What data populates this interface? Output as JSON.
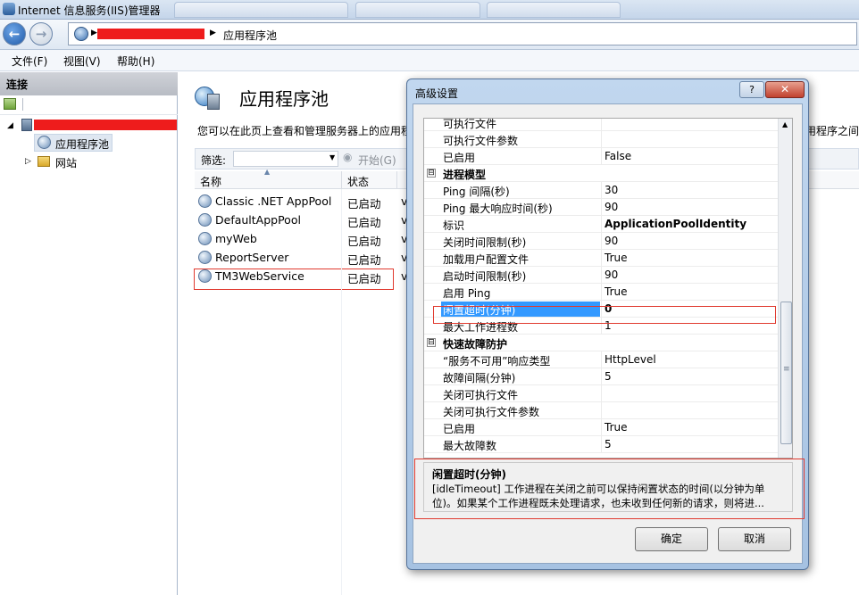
{
  "window": {
    "title": "Internet 信息服务(IIS)管理器"
  },
  "address": {
    "breadcrumb": "应用程序池"
  },
  "menu": [
    "文件(F)",
    "视图(V)",
    "帮助(H)"
  ],
  "connections": {
    "header": "连接",
    "tree": {
      "app_pools": "应用程序池",
      "sites": "网站"
    }
  },
  "main": {
    "title": "应用程序池",
    "description": "您可以在此页上查看和管理服务器上的应用程",
    "description_tail": "用程序之间",
    "filter_label": "筛选:",
    "start_label": "开始(G)",
    "columns": [
      "名称",
      "状态"
    ],
    "pools": [
      {
        "name": "Classic .NET AppPool",
        "status": "已启动",
        "extra": "v"
      },
      {
        "name": "DefaultAppPool",
        "status": "已启动",
        "extra": "v"
      },
      {
        "name": "myWeb",
        "status": "已启动",
        "extra": "v"
      },
      {
        "name": "ReportServer",
        "status": "已启动",
        "extra": "v"
      },
      {
        "name": "TM3WebService",
        "status": "已启动",
        "extra": "v"
      }
    ]
  },
  "dialog": {
    "title": "高级设置",
    "help": "?",
    "rows": [
      {
        "name": "可执行文件",
        "value": ""
      },
      {
        "name": "可执行文件参数",
        "value": ""
      },
      {
        "name": "已启用",
        "value": "False"
      },
      {
        "name": "进程模型",
        "value": "",
        "category": "⊟"
      },
      {
        "name": "Ping 间隔(秒)",
        "value": "30"
      },
      {
        "name": "Ping 最大响应时间(秒)",
        "value": "90"
      },
      {
        "name": "标识",
        "value": "ApplicationPoolIdentity"
      },
      {
        "name": "关闭时间限制(秒)",
        "value": "90"
      },
      {
        "name": "加载用户配置文件",
        "value": "True"
      },
      {
        "name": "启动时间限制(秒)",
        "value": "90"
      },
      {
        "name": "启用 Ping",
        "value": "True"
      },
      {
        "name": "闲置超时(分钟)",
        "value": "0"
      },
      {
        "name": "最大工作进程数",
        "value": "1"
      },
      {
        "name": "快速故障防护",
        "value": "",
        "category": "⊟"
      },
      {
        "name": "“服务不可用”响应类型",
        "value": "HttpLevel"
      },
      {
        "name": "故障间隔(分钟)",
        "value": "5"
      },
      {
        "name": "关闭可执行文件",
        "value": ""
      },
      {
        "name": "关闭可执行文件参数",
        "value": ""
      },
      {
        "name": "已启用",
        "value": "True"
      },
      {
        "name": "最大故障数",
        "value": "5"
      }
    ],
    "desc": {
      "title": "闲置超时(分钟)",
      "line1": "[idleTimeout] 工作进程在关闭之前可以保持闲置状态的时间(以分钟为单",
      "line2": "位)。如果某个工作进程既未处理请求，也未收到任何新的请求，则将进..."
    },
    "ok": "确定",
    "cancel": "取消"
  }
}
